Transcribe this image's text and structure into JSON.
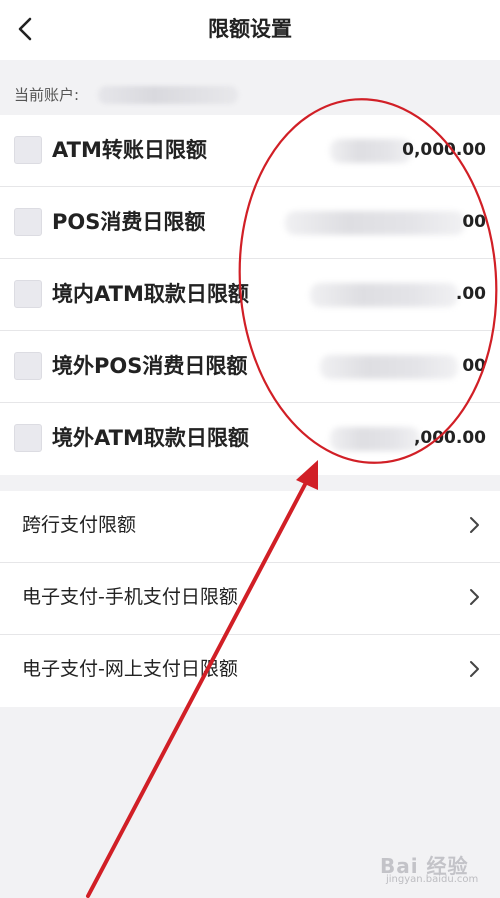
{
  "header": {
    "title": "限额设置",
    "back_icon": "chevron-left-icon"
  },
  "account": {
    "label": "当前账户:"
  },
  "limits": [
    {
      "label": "ATM转账日限额",
      "value": "0,000.00"
    },
    {
      "label": "POS消费日限额",
      "value": "00"
    },
    {
      "label": "境内ATM取款日限额",
      "value": ".00"
    },
    {
      "label": "境外POS消费日限额",
      "value": "00"
    },
    {
      "label": "境外ATM取款日限额",
      "value": ",000.00"
    }
  ],
  "payments": [
    {
      "label": "跨行支付限额"
    },
    {
      "label": "电子支付-手机支付日限额"
    },
    {
      "label": "电子支付-网上支付日限额"
    }
  ],
  "annotation": {
    "color": "#d11f26"
  },
  "watermark": {
    "text": "Bai 经验",
    "sub": "jingyan.baidu.com"
  }
}
